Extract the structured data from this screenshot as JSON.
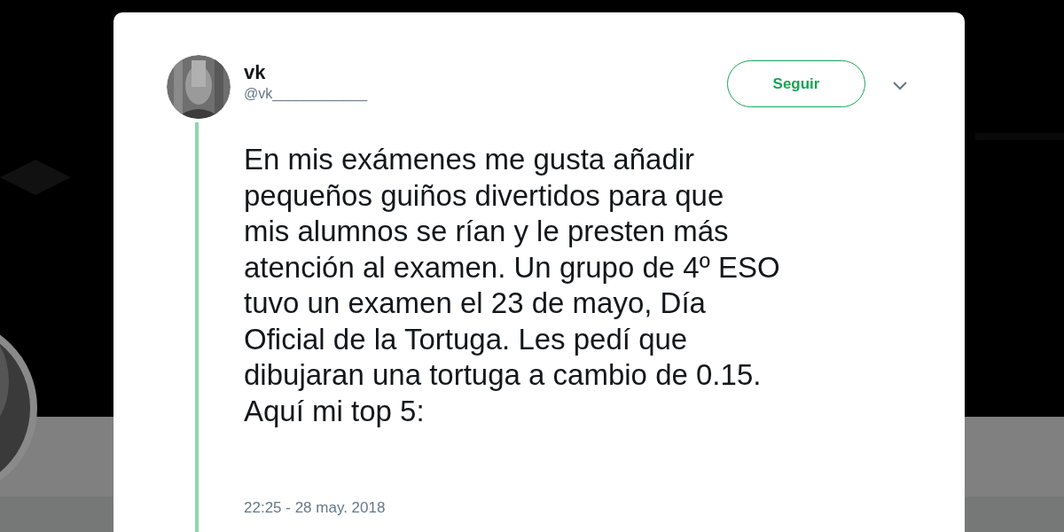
{
  "tweet": {
    "name": "vk",
    "handle": "@vk____________",
    "follow_button": "Seguir",
    "text": "En mis exámenes me gusta añadir\npequeños guiños divertidos para que\nmis alumnos se rían y le presten más\natención al examen. Un grupo de 4º ESO\ntuvo un examen el 23 de mayo, Día\nOficial de la Tortuga. Les pedí que\ndibujaran una tortuga a cambio de 0.15.\nAquí mi top 5:",
    "timestamp": "22:25 - 28 may. 2018"
  }
}
